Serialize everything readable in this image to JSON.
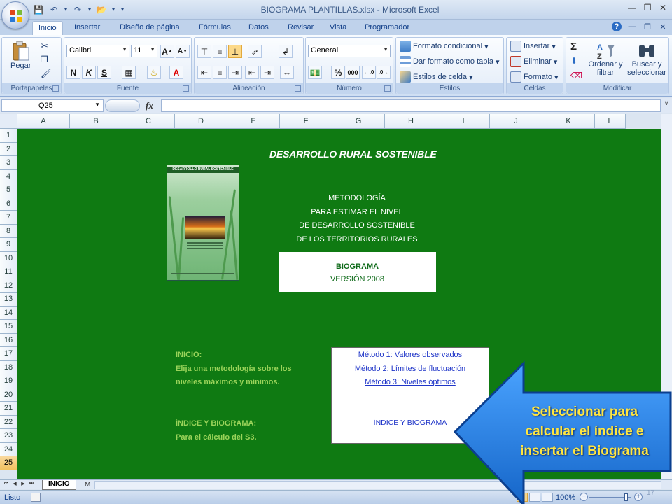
{
  "window": {
    "title": "BIOGRAMA PLANTILLAS.xlsx - Microsoft Excel"
  },
  "tabs": [
    "Inicio",
    "Insertar",
    "Diseño de página",
    "Fórmulas",
    "Datos",
    "Revisar",
    "Vista",
    "Programador"
  ],
  "ribbon": {
    "portapapeles": {
      "label": "Portapapeles",
      "paste": "Pegar"
    },
    "fuente": {
      "label": "Fuente",
      "font": "Calibri",
      "size": "11",
      "bold": "N",
      "italic": "K",
      "underline": "S"
    },
    "alineacion": {
      "label": "Alineación"
    },
    "numero": {
      "label": "Número",
      "format": "General",
      "percent": "%",
      "thousands": "000"
    },
    "estilos": {
      "label": "Estilos",
      "cond": "Formato condicional",
      "table": "Dar formato como tabla",
      "cell": "Estilos de celda"
    },
    "celdas": {
      "label": "Celdas",
      "insert": "Insertar",
      "delete": "Eliminar",
      "format": "Formato"
    },
    "modificar": {
      "label": "Modificar",
      "sort": "Ordenar y filtrar",
      "find": "Buscar y seleccionar"
    }
  },
  "formula_bar": {
    "name_box": "Q25",
    "fx": "fx"
  },
  "columns": [
    "A",
    "B",
    "C",
    "D",
    "E",
    "F",
    "G",
    "H",
    "I",
    "J",
    "K",
    "L"
  ],
  "rows": [
    "1",
    "2",
    "3",
    "4",
    "5",
    "6",
    "7",
    "8",
    "9",
    "10",
    "11",
    "12",
    "13",
    "14",
    "15",
    "16",
    "17",
    "18",
    "19",
    "20",
    "21",
    "22",
    "23",
    "24",
    "25"
  ],
  "selected_row": "25",
  "sheet": {
    "heading": "DESARROLLO RURAL SOSTENIBLE",
    "book_title": "DESARROLLO RURAL SOSTENIBLE",
    "metodologia": [
      "METODOLOGÍA",
      "PARA ESTIMAR EL NIVEL",
      "DE DESARROLLO SOSTENIBLE",
      "DE LOS TERRITORIOS RURALES"
    ],
    "biograma": {
      "title": "BIOGRAMA",
      "version": "VERSIÓN 2008"
    },
    "inicio": [
      "INICIO:",
      "Elija una metodología sobre los",
      "niveles máximos y mínimos."
    ],
    "indice": [
      "ÍNDICE Y BIOGRAMA:",
      "Para el cálculo del S3."
    ],
    "links": [
      "Método 1: Valores observados",
      "Método 2: Límites de fluctuación",
      "Método 3: Niveles óptimos"
    ],
    "index_link": "ÍNDICE Y BIOGRAMA"
  },
  "callout": {
    "lines": [
      "Seleccionar para",
      "calcular el índice e",
      "insertar el Biograma"
    ],
    "fill": "#1e7fe0",
    "text_color": "#ffe640"
  },
  "sheet_tabs": {
    "active": "INICIO",
    "next": "M"
  },
  "status": {
    "ready": "Listo",
    "zoom": "100%",
    "slide_number": "17"
  },
  "colors": {
    "sheet_bg": "#0f7a12",
    "accent_text": "#9ad35a",
    "link": "#1f35c8"
  }
}
